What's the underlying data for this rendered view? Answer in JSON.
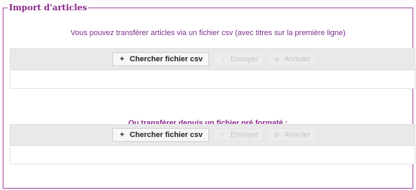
{
  "legend": "Import d'articles",
  "section1": {
    "intro": "Vous pouvez transférer articles via un fichier csv (avec titres sur la première ligne)",
    "browse_label": "Chercher fichier csv",
    "browse_icon": "+",
    "send_label": "Envoyer",
    "send_icon": "↑",
    "cancel_label": "Annuler",
    "cancel_icon": "⊘"
  },
  "section2": {
    "intro": "Ou transférer depuis un fichier pré formaté :",
    "browse_label": "Chercher fichier csv",
    "browse_icon": "+",
    "send_label": "Envoyer",
    "send_icon": "↑",
    "cancel_label": "Annuler",
    "cancel_icon": "⊘"
  },
  "colors": {
    "accent": "#8c2a8c",
    "toolbar_bg": "#e9e9e9"
  }
}
